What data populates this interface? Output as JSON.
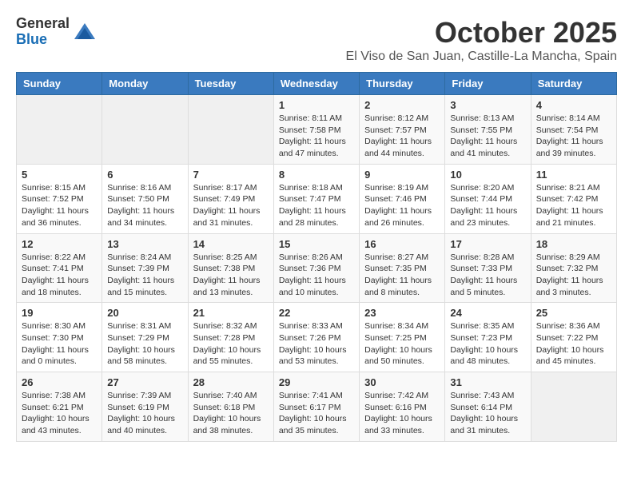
{
  "header": {
    "logo_general": "General",
    "logo_blue": "Blue",
    "month": "October 2025",
    "location": "El Viso de San Juan, Castille-La Mancha, Spain"
  },
  "weekdays": [
    "Sunday",
    "Monday",
    "Tuesday",
    "Wednesday",
    "Thursday",
    "Friday",
    "Saturday"
  ],
  "weeks": [
    [
      {
        "day": "",
        "info": ""
      },
      {
        "day": "",
        "info": ""
      },
      {
        "day": "",
        "info": ""
      },
      {
        "day": "1",
        "info": "Sunrise: 8:11 AM\nSunset: 7:58 PM\nDaylight: 11 hours and 47 minutes."
      },
      {
        "day": "2",
        "info": "Sunrise: 8:12 AM\nSunset: 7:57 PM\nDaylight: 11 hours and 44 minutes."
      },
      {
        "day": "3",
        "info": "Sunrise: 8:13 AM\nSunset: 7:55 PM\nDaylight: 11 hours and 41 minutes."
      },
      {
        "day": "4",
        "info": "Sunrise: 8:14 AM\nSunset: 7:54 PM\nDaylight: 11 hours and 39 minutes."
      }
    ],
    [
      {
        "day": "5",
        "info": "Sunrise: 8:15 AM\nSunset: 7:52 PM\nDaylight: 11 hours and 36 minutes."
      },
      {
        "day": "6",
        "info": "Sunrise: 8:16 AM\nSunset: 7:50 PM\nDaylight: 11 hours and 34 minutes."
      },
      {
        "day": "7",
        "info": "Sunrise: 8:17 AM\nSunset: 7:49 PM\nDaylight: 11 hours and 31 minutes."
      },
      {
        "day": "8",
        "info": "Sunrise: 8:18 AM\nSunset: 7:47 PM\nDaylight: 11 hours and 28 minutes."
      },
      {
        "day": "9",
        "info": "Sunrise: 8:19 AM\nSunset: 7:46 PM\nDaylight: 11 hours and 26 minutes."
      },
      {
        "day": "10",
        "info": "Sunrise: 8:20 AM\nSunset: 7:44 PM\nDaylight: 11 hours and 23 minutes."
      },
      {
        "day": "11",
        "info": "Sunrise: 8:21 AM\nSunset: 7:42 PM\nDaylight: 11 hours and 21 minutes."
      }
    ],
    [
      {
        "day": "12",
        "info": "Sunrise: 8:22 AM\nSunset: 7:41 PM\nDaylight: 11 hours and 18 minutes."
      },
      {
        "day": "13",
        "info": "Sunrise: 8:24 AM\nSunset: 7:39 PM\nDaylight: 11 hours and 15 minutes."
      },
      {
        "day": "14",
        "info": "Sunrise: 8:25 AM\nSunset: 7:38 PM\nDaylight: 11 hours and 13 minutes."
      },
      {
        "day": "15",
        "info": "Sunrise: 8:26 AM\nSunset: 7:36 PM\nDaylight: 11 hours and 10 minutes."
      },
      {
        "day": "16",
        "info": "Sunrise: 8:27 AM\nSunset: 7:35 PM\nDaylight: 11 hours and 8 minutes."
      },
      {
        "day": "17",
        "info": "Sunrise: 8:28 AM\nSunset: 7:33 PM\nDaylight: 11 hours and 5 minutes."
      },
      {
        "day": "18",
        "info": "Sunrise: 8:29 AM\nSunset: 7:32 PM\nDaylight: 11 hours and 3 minutes."
      }
    ],
    [
      {
        "day": "19",
        "info": "Sunrise: 8:30 AM\nSunset: 7:30 PM\nDaylight: 11 hours and 0 minutes."
      },
      {
        "day": "20",
        "info": "Sunrise: 8:31 AM\nSunset: 7:29 PM\nDaylight: 10 hours and 58 minutes."
      },
      {
        "day": "21",
        "info": "Sunrise: 8:32 AM\nSunset: 7:28 PM\nDaylight: 10 hours and 55 minutes."
      },
      {
        "day": "22",
        "info": "Sunrise: 8:33 AM\nSunset: 7:26 PM\nDaylight: 10 hours and 53 minutes."
      },
      {
        "day": "23",
        "info": "Sunrise: 8:34 AM\nSunset: 7:25 PM\nDaylight: 10 hours and 50 minutes."
      },
      {
        "day": "24",
        "info": "Sunrise: 8:35 AM\nSunset: 7:23 PM\nDaylight: 10 hours and 48 minutes."
      },
      {
        "day": "25",
        "info": "Sunrise: 8:36 AM\nSunset: 7:22 PM\nDaylight: 10 hours and 45 minutes."
      }
    ],
    [
      {
        "day": "26",
        "info": "Sunrise: 7:38 AM\nSunset: 6:21 PM\nDaylight: 10 hours and 43 minutes."
      },
      {
        "day": "27",
        "info": "Sunrise: 7:39 AM\nSunset: 6:19 PM\nDaylight: 10 hours and 40 minutes."
      },
      {
        "day": "28",
        "info": "Sunrise: 7:40 AM\nSunset: 6:18 PM\nDaylight: 10 hours and 38 minutes."
      },
      {
        "day": "29",
        "info": "Sunrise: 7:41 AM\nSunset: 6:17 PM\nDaylight: 10 hours and 35 minutes."
      },
      {
        "day": "30",
        "info": "Sunrise: 7:42 AM\nSunset: 6:16 PM\nDaylight: 10 hours and 33 minutes."
      },
      {
        "day": "31",
        "info": "Sunrise: 7:43 AM\nSunset: 6:14 PM\nDaylight: 10 hours and 31 minutes."
      },
      {
        "day": "",
        "info": ""
      }
    ]
  ]
}
